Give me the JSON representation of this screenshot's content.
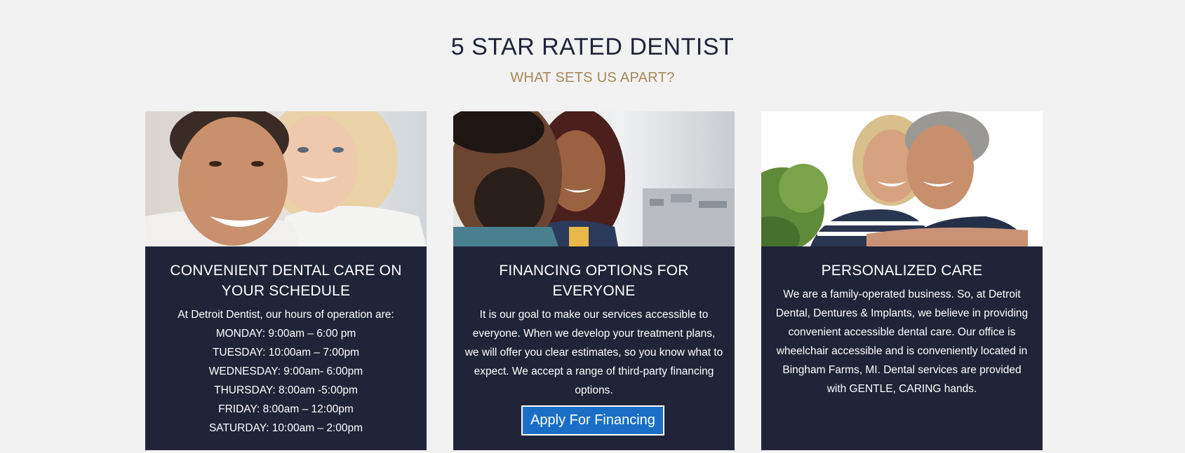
{
  "header": {
    "title": "5 STAR RATED DENTIST",
    "subtitle": "WHAT SETS US APART?"
  },
  "colors": {
    "page_background": "#f2f2f2",
    "card_background": "#1f2438",
    "title_color": "#1f2438",
    "subtitle_color": "#a6885a",
    "button_color": "#1a6fc4"
  },
  "cards": [
    {
      "image": "couple-smiling-photo",
      "title": "CONVENIENT DENTAL CARE ON YOUR SCHEDULE",
      "intro": "At Detroit Dentist, our hours of operation are:",
      "hours": [
        "MONDAY: 9:00am – 6:00 pm",
        "TUESDAY: 10:00am – 7:00pm",
        "WEDNESDAY: 9:00am- 6:00pm",
        "THURSDAY: 8:00am -5:00pm",
        "FRIDAY: 8:00am – 12:00pm",
        "SATURDAY: 10:00am – 2:00pm"
      ]
    },
    {
      "image": "young-couple-photo",
      "title": "FINANCING OPTIONS FOR EVERYONE",
      "text": "It is our goal to make our services accessible to everyone. When we develop your treatment plans, we will offer you clear estimates, so you know what to expect. We accept a range of third-party financing options.",
      "button_label": "Apply For Financing"
    },
    {
      "image": "older-couple-hugging-photo",
      "title": "PERSONALIZED CARE",
      "text": "We are a family-operated business. So, at Detroit Dental, Dentures & Implants, we believe in providing convenient accessible dental care. Our office is wheelchair accessible and is conveniently located in Bingham Farms, MI. Dental services are provided with GENTLE, CARING hands."
    }
  ]
}
